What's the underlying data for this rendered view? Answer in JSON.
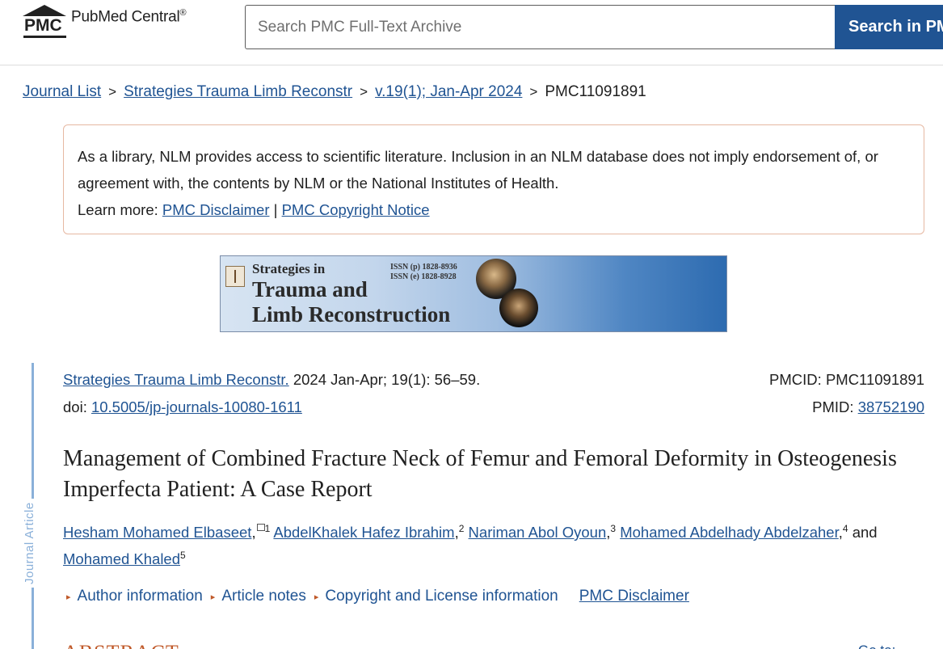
{
  "header": {
    "logo_mark": "PMC",
    "logo_text": "PubMed Central",
    "logo_reg": "®",
    "search_placeholder": "Search PMC Full-Text Archive",
    "search_button": "Search in PMC"
  },
  "breadcrumb": {
    "items": [
      "Journal List",
      "Strategies Trauma Limb Reconstr",
      "v.19(1); Jan-Apr 2024"
    ],
    "separator": ">",
    "current": "PMC11091891"
  },
  "notice": {
    "text": "As a library, NLM provides access to scientific literature. Inclusion in an NLM database does not imply endorsement of, or agreement with, the contents by NLM or the National Institutes of Health.",
    "learn_more": "Learn more:",
    "disclaimer_link": "PMC Disclaimer",
    "divider": "|",
    "copyright_link": "PMC Copyright Notice"
  },
  "banner": {
    "line1": "Strategies in",
    "line2": "Trauma and",
    "line3": "Limb Reconstruction",
    "issn_p": "ISSN (p) 1828-8936",
    "issn_e": "ISSN (e) 1828-8928"
  },
  "side_label": "Journal Article",
  "citation": {
    "journal": "Strategies Trauma Limb Reconstr.",
    "details": " 2024 Jan-Apr; 19(1): 56–59.",
    "doi_label": "doi: ",
    "doi": "10.5005/jp-journals-10080-1611",
    "pmcid_label": "PMCID: ",
    "pmcid": "PMC11091891",
    "pmid_label": "PMID: ",
    "pmid": "38752190"
  },
  "article": {
    "title": "Management of Combined Fracture Neck of Femur and Femoral Deformity in Osteogenesis Imperfecta Patient: A Case Report"
  },
  "authors": [
    {
      "name": "Hesham Mohamed Elbaseet",
      "sup": "1"
    },
    {
      "name": "AbdelKhalek Hafez Ibrahim",
      "sup": "2"
    },
    {
      "name": "Nariman Abol Oyoun",
      "sup": "3"
    },
    {
      "name": "Mohamed Abdelhady Abdelzaher",
      "sup": "4"
    },
    {
      "name": "Mohamed Khaled",
      "sup": "5"
    }
  ],
  "authors_and": "and",
  "toggles": {
    "author_info": "Author information",
    "article_notes": "Article notes",
    "copyright": "Copyright and License information",
    "disclaimer": "PMC Disclaimer"
  },
  "section_peek": "ABSTRACT",
  "right_peek": "Go to:"
}
